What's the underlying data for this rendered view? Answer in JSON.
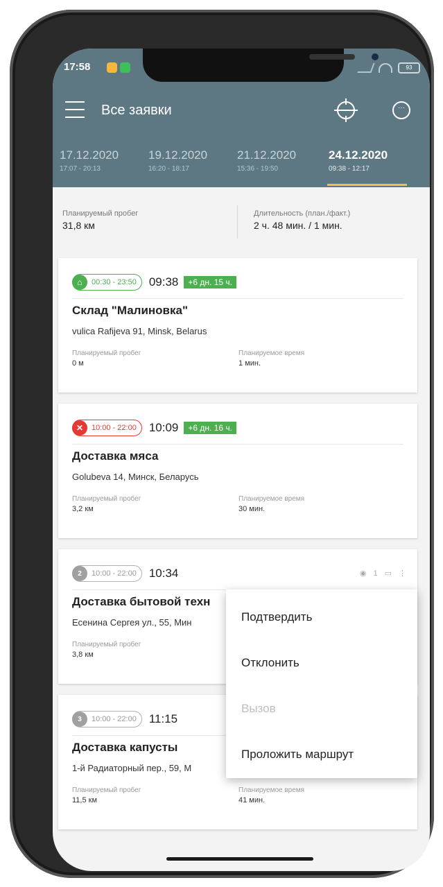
{
  "status": {
    "time": "17:58",
    "battery": "93"
  },
  "appbar": {
    "title": "Все заявки",
    "gps_icon": "crosshair-icon",
    "chat_icon": "chat-icon",
    "menu_icon": "hamburger-icon"
  },
  "tabs": [
    {
      "date": "17.12.2020",
      "time": "17:07 - 20:13"
    },
    {
      "date": "19.12.2020",
      "time": "16:20 - 18:17"
    },
    {
      "date": "21.12.2020",
      "time": "15:36 - 19:50"
    },
    {
      "date": "24.12.2020",
      "time": "09:38 - 12:17",
      "active": true
    }
  ],
  "summary": {
    "mileage_label": "Планируемый пробег",
    "mileage_value": "31,8  км",
    "duration_label": "Длительность (план./факт.)",
    "duration_value": "2 ч. 48 мин. / 1 мин."
  },
  "cards": [
    {
      "window": "00:30 - 23:50",
      "time": "09:38",
      "delay": "+6 дн. 15 ч.",
      "title": "Склад \"Малиновка\"",
      "address": "vulica Rafijeva 91, Minsk, Belarus",
      "m1_label": "Планируемый пробег",
      "m1_value": "0 м",
      "m2_label": "Планируемое время",
      "m2_value": "1 мин."
    },
    {
      "window": "10:00 - 22:00",
      "time": "10:09",
      "delay": "+6 дн. 16 ч.",
      "title": "Доставка мяса",
      "address": "Golubeva 14, Минск, Беларусь",
      "m1_label": "Планируемый пробег",
      "m1_value": "3,2  км",
      "m2_label": "Планируемое время",
      "m2_value": "30 мин."
    },
    {
      "badge": "2",
      "window": "10:00 - 22:00",
      "time": "10:34",
      "title": "Доставка бытовой техн",
      "address": "Есенина Сергея ул., 55, Мин",
      "m1_label": "Планируемый пробег",
      "m1_value": "3,8  км",
      "count": "1"
    },
    {
      "badge": "3",
      "window": "10:00 - 22:00",
      "time": "11:15",
      "title": "Доставка капусты",
      "address": "1-й Радиаторный пер., 59, М",
      "m1_label": "Планируемый пробег",
      "m1_value": "11,5  км",
      "m2_label": "Планируемое время",
      "m2_value": "41 мин."
    }
  ],
  "context_menu": {
    "confirm": "Подтвердить",
    "reject": "Отклонить",
    "call": "Вызов",
    "route": "Проложить маршрут"
  }
}
